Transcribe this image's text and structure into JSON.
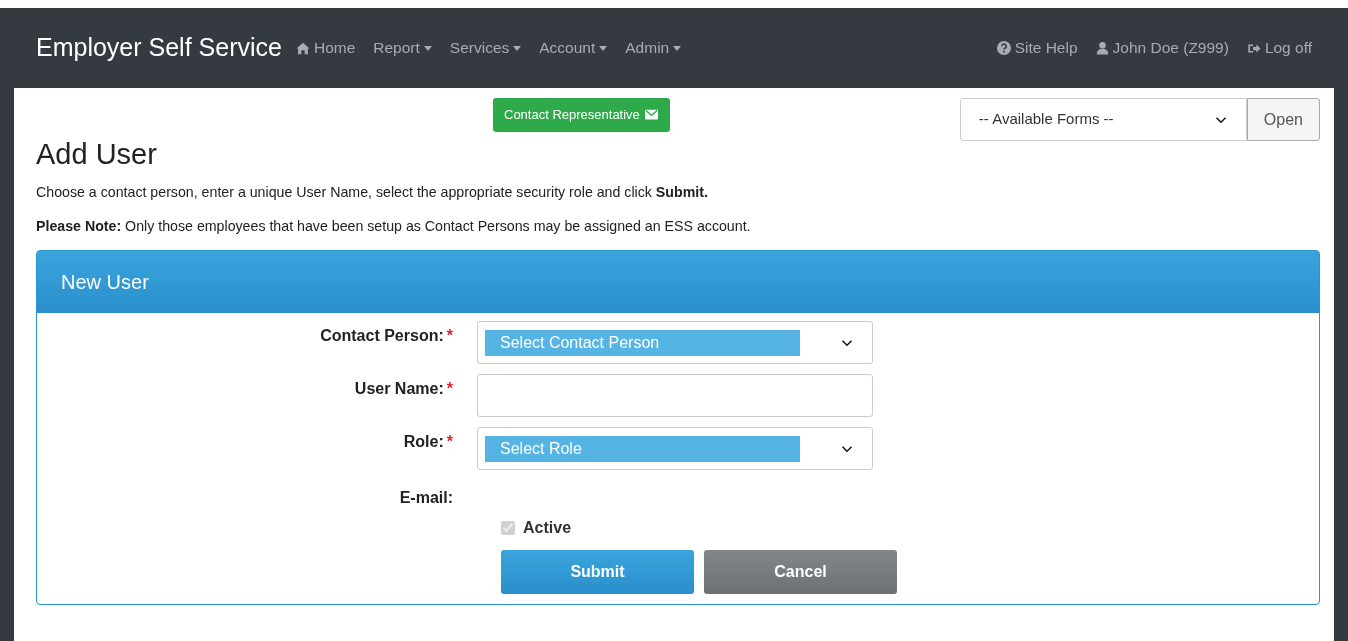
{
  "navbar": {
    "brand": "Employer Self Service",
    "items": [
      {
        "label": "Home",
        "dropdown": false
      },
      {
        "label": "Report",
        "dropdown": true
      },
      {
        "label": "Services",
        "dropdown": true
      },
      {
        "label": "Account",
        "dropdown": true
      },
      {
        "label": "Admin",
        "dropdown": true
      }
    ],
    "right_items": [
      {
        "label": "Site Help"
      },
      {
        "label": "John Doe (Z999)"
      },
      {
        "label": "Log off"
      }
    ]
  },
  "contact_button": {
    "label": "Contact Representative"
  },
  "forms_select": {
    "value": "-- Available Forms --",
    "button": "Open"
  },
  "page_title": "Add User",
  "instructions": [
    "Choose a contact person, enter a unique User Name, select the appropriate security role and click **Submit.**",
    "**Please Note:** Only those employees that have been setup as Contact Persons may be assigned an ESS account."
  ],
  "panel": {
    "title": "New User",
    "fields": [
      {
        "kind": "select",
        "label": "Contact Person:",
        "required_mark": "*",
        "value": "Select Contact Person"
      },
      {
        "kind": "text",
        "label": "User Name:",
        "required_mark": "*"
      },
      {
        "kind": "select",
        "label": "Role:",
        "required_mark": "*",
        "value": "Select Role"
      },
      {
        "kind": "static",
        "label": "E-mail:"
      }
    ],
    "active": {
      "label": "Active",
      "checked": true,
      "disabled": true
    },
    "buttons": [
      {
        "kind": "primary",
        "label": "Submit"
      },
      {
        "kind": "secondary",
        "label": "Cancel"
      }
    ]
  }
}
